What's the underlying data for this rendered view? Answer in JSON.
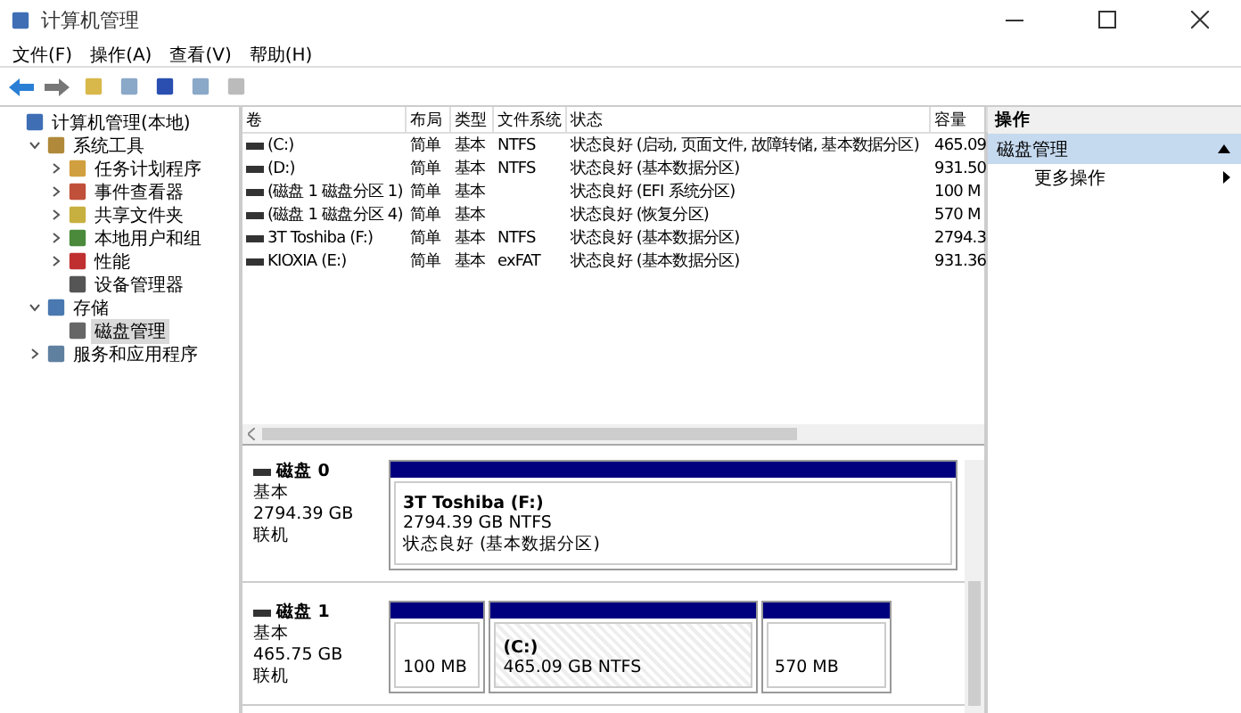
{
  "window": {
    "title": "计算机管理"
  },
  "menu": [
    "文件(F)",
    "操作(A)",
    "查看(V)",
    "帮助(H)"
  ],
  "tree": [
    {
      "label": "计算机管理(本地)",
      "selected": false,
      "children": [
        {
          "label": "系统工具",
          "expanded": true,
          "selected": false,
          "children": [
            {
              "label": "任务计划程序",
              "expanded": false,
              "selected": false
            },
            {
              "label": "事件查看器",
              "expanded": false,
              "selected": false
            },
            {
              "label": "共享文件夹",
              "expanded": false,
              "selected": false
            },
            {
              "label": "本地用户和组",
              "expanded": false,
              "selected": false
            },
            {
              "label": "性能",
              "expanded": false,
              "selected": false
            },
            {
              "label": "设备管理器",
              "selected": false
            }
          ]
        },
        {
          "label": "存储",
          "expanded": true,
          "selected": false,
          "children": [
            {
              "label": "磁盘管理",
              "selected": true
            }
          ]
        },
        {
          "label": "服务和应用程序",
          "expanded": false,
          "selected": false
        }
      ]
    }
  ],
  "table": {
    "columns": [
      "卷",
      "布局",
      "类型",
      "文件系统",
      "状态",
      "容量"
    ],
    "rows": [
      [
        "(C:)",
        "简单",
        "基本",
        "NTFS",
        "状态良好 (启动, 页面文件, 故障转储, 基本数据分区)",
        "465.09"
      ],
      [
        "(D:)",
        "简单",
        "基本",
        "NTFS",
        "状态良好 (基本数据分区)",
        "931.50"
      ],
      [
        "(磁盘 1 磁盘分区 1)",
        "简单",
        "基本",
        "",
        "状态良好 (EFI 系统分区)",
        "100 M"
      ],
      [
        "(磁盘 1 磁盘分区 4)",
        "简单",
        "基本",
        "",
        "状态良好 (恢复分区)",
        "570 M"
      ],
      [
        "3T Toshiba (F:)",
        "简单",
        "基本",
        "NTFS",
        "状态良好 (基本数据分区)",
        "2794.3"
      ],
      [
        "KIOXIA (E:)",
        "简单",
        "基本",
        "exFAT",
        "状态良好 (基本数据分区)",
        "931.36"
      ]
    ]
  },
  "disks": [
    {
      "name": "磁盘 0",
      "type": "基本",
      "size": "2794.39 GB",
      "status": "联机",
      "partitions": [
        {
          "name": "3T Toshiba  (F:)",
          "size": "2794.39 GB NTFS",
          "status": "状态良好 (基本数据分区)",
          "hatched": false
        }
      ]
    },
    {
      "name": "磁盘 1",
      "type": "基本",
      "size": "465.75 GB",
      "status": "联机",
      "partitions": [
        {
          "size": "100 MB",
          "hatched": false
        },
        {
          "name": "(C:)",
          "size": "465.09 GB NTFS",
          "hatched": true
        },
        {
          "size": "570 MB",
          "hatched": false
        }
      ]
    }
  ],
  "actions": {
    "title": "操作",
    "section": "磁盘管理",
    "items": [
      "更多操作"
    ]
  }
}
